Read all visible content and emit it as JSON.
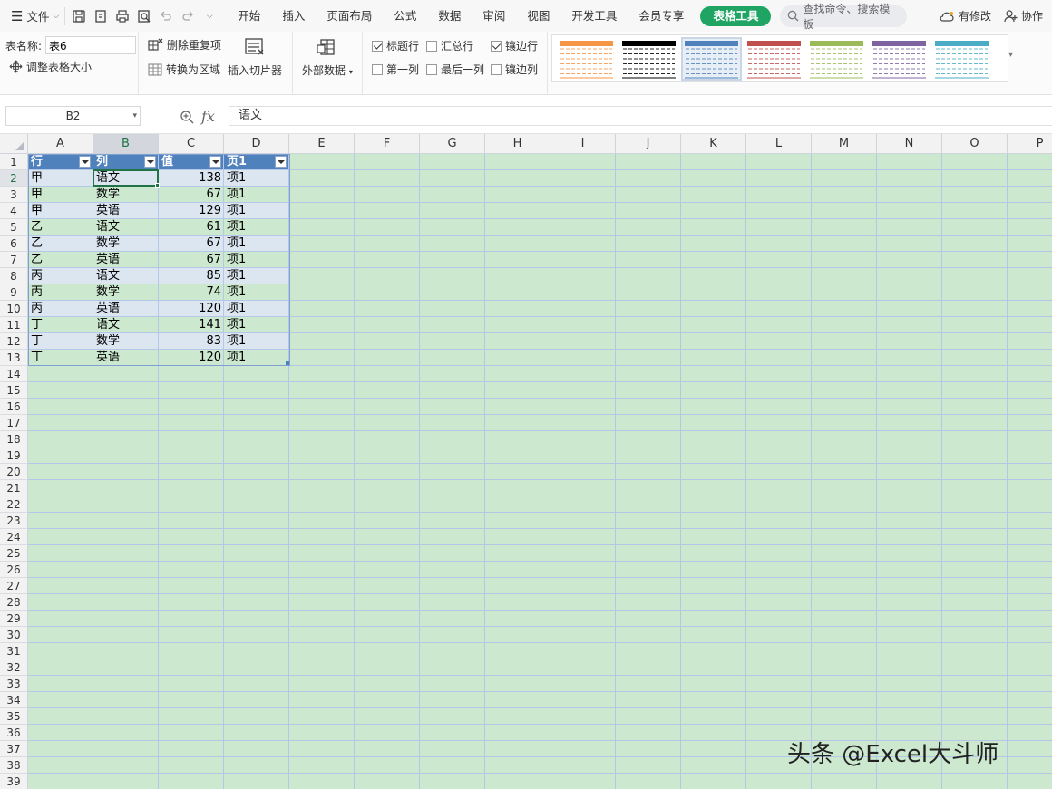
{
  "menubar": {
    "file_label": "文件",
    "tabs": [
      "开始",
      "插入",
      "页面布局",
      "公式",
      "数据",
      "审阅",
      "视图",
      "开发工具",
      "会员专享"
    ],
    "active_tab": "表格工具",
    "search_placeholder": "查找命令、搜索模板",
    "modified_label": "有修改",
    "collab_label": "协作"
  },
  "ribbon": {
    "table_name_label": "表名称:",
    "table_name_value": "表6",
    "resize_label": "调整表格大小",
    "remove_dup_label": "删除重复项",
    "to_range_label": "转换为区域",
    "slicer_label": "插入切片器",
    "external_label": "外部数据",
    "options": [
      {
        "label": "标题行",
        "checked": true
      },
      {
        "label": "汇总行",
        "checked": false
      },
      {
        "label": "镶边行",
        "checked": true
      },
      {
        "label": "第一列",
        "checked": false
      },
      {
        "label": "最后一列",
        "checked": false
      },
      {
        "label": "镶边列",
        "checked": false
      }
    ],
    "style_colors": [
      "#f79646",
      "#000000",
      "#4f81bd",
      "#c0504d",
      "#9bbb59",
      "#8064a2",
      "#4bacc6"
    ]
  },
  "formula": {
    "name_box": "B2",
    "fx_label": "fx",
    "content": "语文"
  },
  "sheet": {
    "columns": [
      "A",
      "B",
      "C",
      "D",
      "E",
      "F",
      "G",
      "H",
      "I",
      "J",
      "K",
      "L",
      "M",
      "N",
      "O",
      "P"
    ],
    "selected_column": "B",
    "selected_row": 2,
    "row_count": 39,
    "table_header": [
      "行",
      "列",
      "值",
      "页1"
    ],
    "table_rows": [
      [
        "甲",
        "语文",
        "138",
        "项1"
      ],
      [
        "甲",
        "数学",
        "67",
        "项1"
      ],
      [
        "甲",
        "英语",
        "129",
        "项1"
      ],
      [
        "乙",
        "语文",
        "61",
        "项1"
      ],
      [
        "乙",
        "数学",
        "67",
        "项1"
      ],
      [
        "乙",
        "英语",
        "67",
        "项1"
      ],
      [
        "丙",
        "语文",
        "85",
        "项1"
      ],
      [
        "丙",
        "数学",
        "74",
        "项1"
      ],
      [
        "丙",
        "英语",
        "120",
        "项1"
      ],
      [
        "丁",
        "语文",
        "141",
        "项1"
      ],
      [
        "丁",
        "数学",
        "83",
        "项1"
      ],
      [
        "丁",
        "英语",
        "120",
        "项1"
      ]
    ],
    "header_color": "#4f81bd",
    "band_color": "#dce6f1",
    "sheet_bg": "#cce8cf",
    "accent": "#217346"
  },
  "watermark": "头条 @Excel大斗师"
}
